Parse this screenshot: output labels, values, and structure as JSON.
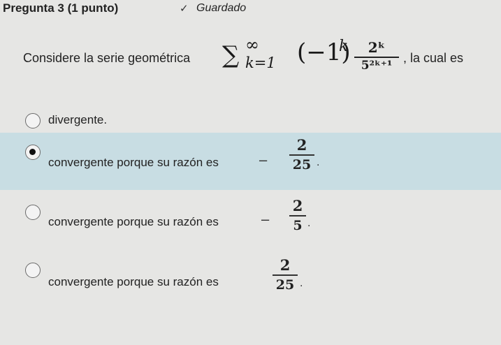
{
  "header": {
    "question_title": "Pregunta 3 (1 punto)",
    "saved_icon": "check-icon",
    "saved_label": "Guardado"
  },
  "statement": {
    "prefix": "Considere la serie geométrica",
    "formula": {
      "sum_symbol": "∑",
      "upper_limit": "∞",
      "lower_limit": "k=1",
      "base": "(−1)",
      "exponent": "k",
      "fraction_numerator": "2ᵏ",
      "fraction_denominator": "5²ᵏ⁺¹"
    },
    "suffix": ", la cual es"
  },
  "options": [
    {
      "label": "divergente.",
      "selected": false
    },
    {
      "label": "convergente porque su razón es",
      "selected": true,
      "sign": "−",
      "numerator": "2",
      "denominator": "25",
      "end": "."
    },
    {
      "label": "convergente porque su razón es",
      "selected": false,
      "sign": "−",
      "numerator": "2",
      "denominator": "5",
      "end": "."
    },
    {
      "label": "convergente porque su razón es",
      "selected": false,
      "sign": "",
      "numerator": "2",
      "denominator": "25",
      "end": "."
    }
  ],
  "colors": {
    "selected_background": "#c8dde3",
    "page_background": "#e6e6e4"
  }
}
